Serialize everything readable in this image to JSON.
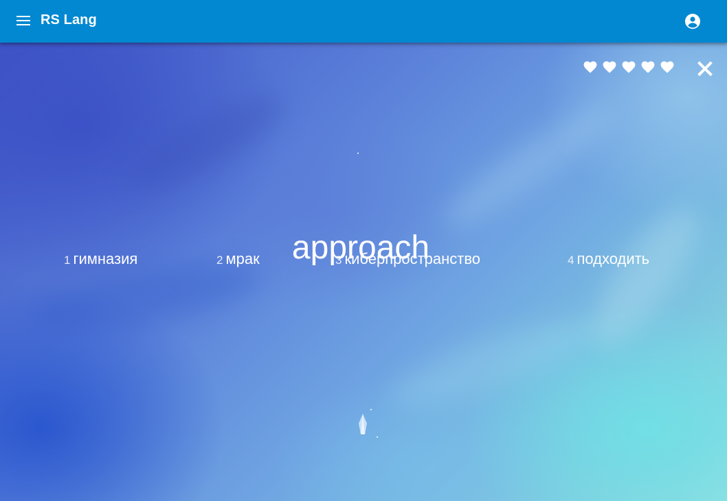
{
  "app": {
    "title": "RS Lang"
  },
  "icons": {
    "menu": "menu-icon",
    "account": "account-circle-icon",
    "life": "heart-icon",
    "close": "close-icon"
  },
  "colors": {
    "appbar": "#0288d1",
    "text": "#ffffff"
  },
  "game": {
    "lives_remaining": 5,
    "lives_total": 5,
    "current_word": "approach",
    "options": [
      {
        "number": "1",
        "word": "гимназия"
      },
      {
        "number": "2",
        "word": "мрак"
      },
      {
        "number": "3",
        "word": "киберпространство"
      },
      {
        "number": "4",
        "word": "подходить"
      }
    ]
  }
}
